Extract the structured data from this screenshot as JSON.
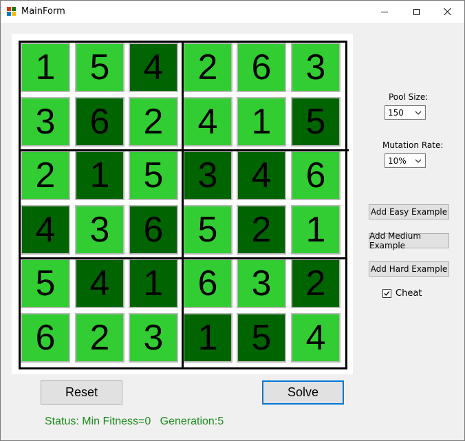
{
  "window": {
    "title": "MainForm"
  },
  "colors": {
    "light_cell": "#32cd32",
    "dark_cell": "#006400",
    "status_text": "#1a8c1a",
    "focus_border": "#0078d7"
  },
  "board": {
    "values": [
      [
        "1",
        "5",
        "4",
        "2",
        "6",
        "3"
      ],
      [
        "3",
        "6",
        "2",
        "4",
        "1",
        "5"
      ],
      [
        "2",
        "1",
        "5",
        "3",
        "4",
        "6"
      ],
      [
        "4",
        "3",
        "6",
        "5",
        "2",
        "1"
      ],
      [
        "5",
        "4",
        "1",
        "6",
        "3",
        "2"
      ],
      [
        "6",
        "2",
        "3",
        "1",
        "5",
        "4"
      ]
    ],
    "shading": [
      [
        "light",
        "light",
        "dark",
        "light",
        "light",
        "light"
      ],
      [
        "light",
        "dark",
        "light",
        "light",
        "light",
        "dark"
      ],
      [
        "light",
        "dark",
        "light",
        "dark",
        "dark",
        "light"
      ],
      [
        "dark",
        "light",
        "dark",
        "light",
        "dark",
        "light"
      ],
      [
        "light",
        "dark",
        "dark",
        "light",
        "light",
        "dark"
      ],
      [
        "light",
        "light",
        "light",
        "dark",
        "dark",
        "light"
      ]
    ]
  },
  "settings": {
    "pool_size_label": "Pool Size:",
    "pool_size_value": "150",
    "mutation_rate_label": "Mutation Rate:",
    "mutation_rate_value": "10%"
  },
  "buttons": {
    "easy": "Add Easy Example",
    "medium": "Add Medium Example",
    "hard": "Add Hard Example",
    "reset": "Reset",
    "solve": "Solve"
  },
  "cheat": {
    "label": "Cheat",
    "checked": true
  },
  "status": {
    "text": "Status: Min Fitness=0   Generation:5"
  }
}
